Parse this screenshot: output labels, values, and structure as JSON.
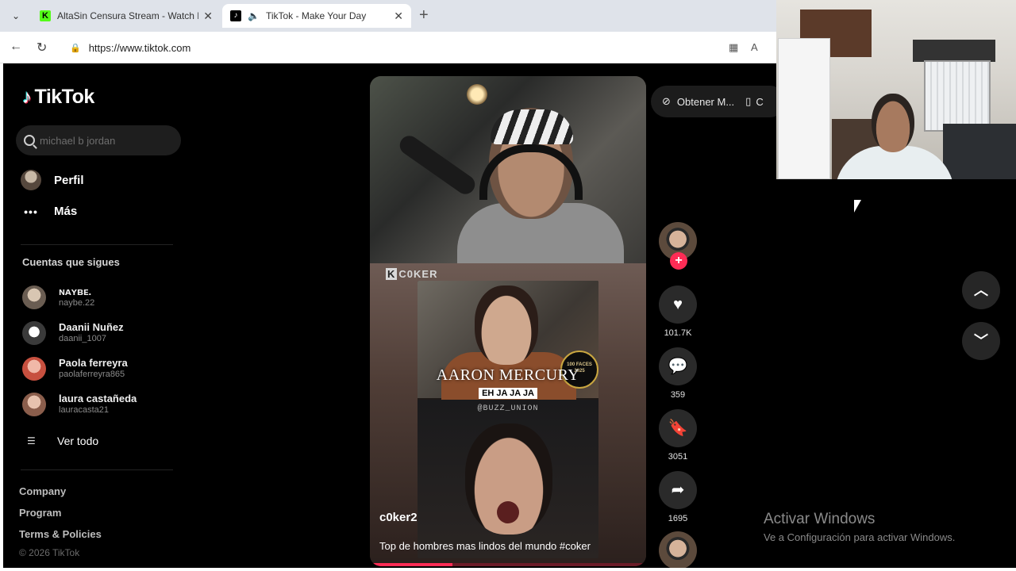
{
  "browser": {
    "tabs": [
      {
        "title": "AltaSin Censura Stream - Watch Li",
        "favicon": "K",
        "active": false
      },
      {
        "title": "TikTok - Make Your Day",
        "favicon": "tiktok-logo",
        "active": true
      }
    ],
    "url": "https://www.tiktok.com"
  },
  "sidebar": {
    "logo": "TikTok",
    "search_placeholder": "michael b jordan",
    "nav": [
      {
        "label": "Perfil",
        "icon": "avatar"
      },
      {
        "label": "Más",
        "icon": "more-icon"
      }
    ],
    "following_title": "Cuentas que sigues",
    "accounts": [
      {
        "name": "ɴᴀʏʙᴇ.",
        "handle": "naybe.22"
      },
      {
        "name": "Daanii Nuñez",
        "handle": "daanii_1007"
      },
      {
        "name": "Paola ferreyra",
        "handle": "paolaferreyra865"
      },
      {
        "name": "laura castañeda",
        "handle": "lauracasta21"
      }
    ],
    "see_all": "Ver todo",
    "footer_links": [
      "Company",
      "Program",
      "Terms & Policies"
    ],
    "copyright": "© 2026 TikTok"
  },
  "video": {
    "overlay_brand": "C0KER",
    "overlay_name": "AARON MERCURY",
    "overlay_sub": "EH JA JA JA",
    "overlay_credit": "@BUZZ_UNION",
    "seal_text": "100 FACES 2025",
    "username": "c0ker2",
    "caption": "Top  de hombres mas lindos del mundo #coker",
    "progress": 0.3
  },
  "actions": {
    "likes": "101.7K",
    "comments": "359",
    "saves": "3051",
    "shares": "1695"
  },
  "top_right": {
    "get_app": "Obtener M...",
    "second_button": "C"
  },
  "windows_notice": {
    "title": "Activar Windows",
    "subtitle": "Ve a Configuración para activar Windows."
  },
  "colors": {
    "tiktok_red": "#fe2c55",
    "page_bg": "#000000",
    "kick_green": "#53fc18"
  }
}
